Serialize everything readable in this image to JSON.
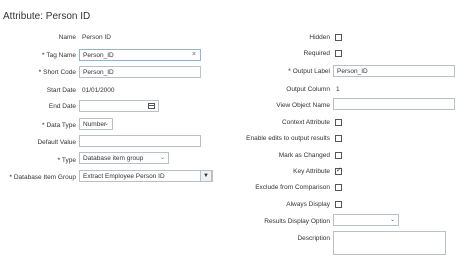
{
  "page": {
    "title": "Attribute: Person ID"
  },
  "left": {
    "name_label": "Name",
    "name_value": "Person ID",
    "tag_name_label": "Tag Name",
    "tag_name_value": "Person_ID",
    "short_code_label": "Short Code",
    "short_code_value": "Person_ID",
    "start_date_label": "Start Date",
    "start_date_value": "01/01/2000",
    "end_date_label": "End Date",
    "end_date_value": "",
    "data_type_label": "Data Type",
    "data_type_value": "Number",
    "default_value_label": "Default Value",
    "default_value_value": "",
    "type_label": "Type",
    "type_value": "Database item group",
    "db_item_group_label": "Database Item Group",
    "db_item_group_value": "Extract Employee Person ID"
  },
  "right": {
    "hidden_label": "Hidden",
    "hidden_checked": false,
    "required_label": "Required",
    "required_checked": false,
    "output_label_label": "Output Label",
    "output_label_value": "Person_ID",
    "output_column_label": "Output Column",
    "output_column_value": "1",
    "view_object_name_label": "View Object Name",
    "view_object_name_value": "",
    "context_attribute_label": "Context Attribute",
    "context_attribute_checked": false,
    "enable_edits_label": "Enable edits to output results",
    "enable_edits_checked": false,
    "mark_changed_label": "Mark as Changed",
    "mark_changed_checked": false,
    "key_attribute_label": "Key Attribute",
    "key_attribute_checked": true,
    "exclude_comparison_label": "Exclude from Comparison",
    "exclude_comparison_checked": false,
    "always_display_label": "Always Display",
    "always_display_checked": false,
    "results_display_option_label": "Results Display Option",
    "results_display_option_value": "",
    "description_label": "Description",
    "description_value": ""
  },
  "icons": {
    "required": "asterisk",
    "clear": "clear-x-icon",
    "dropdown": "chevron-down-icon",
    "calendar": "calendar-icon",
    "checkmark": "checkmark-icon"
  }
}
